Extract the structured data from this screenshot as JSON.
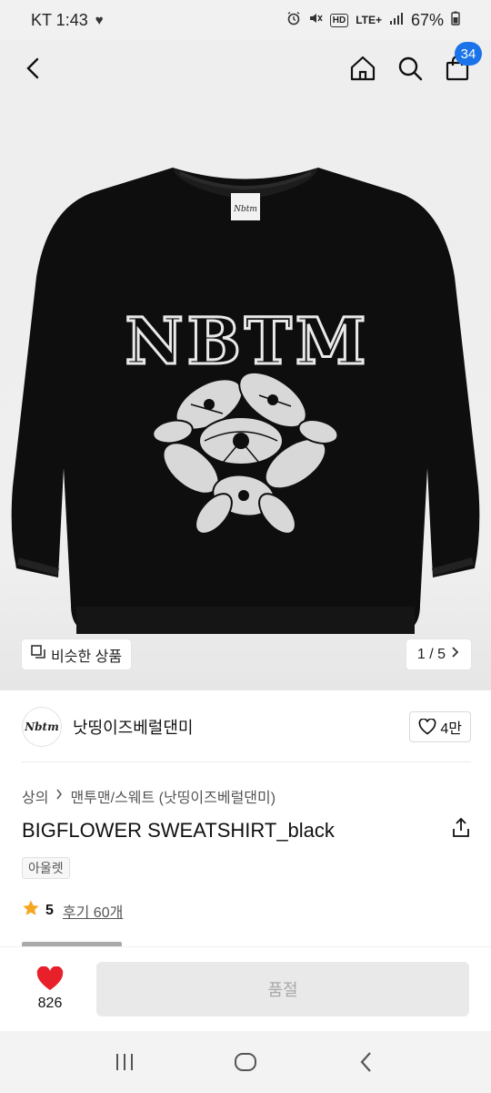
{
  "status_bar": {
    "carrier_time": "KT 1:43",
    "network": "LTE+",
    "battery": "67%"
  },
  "nav": {
    "cart_count": "34"
  },
  "product_image": {
    "similar_label": "비슷한 상품",
    "page_indicator": "1 / 5",
    "print_text": "NBTM",
    "tag_text": "Nbtm"
  },
  "brand": {
    "logo_text": "Nbtm",
    "name": "낫띵이즈베럴댄미",
    "likes": "4만"
  },
  "breadcrumb": {
    "category": "상의",
    "subcategory": "맨투맨/스웨트 (낫띵이즈베럴댄미)"
  },
  "product": {
    "title": "BIGFLOWER SWEATSHIRT_black",
    "tag": "아울렛",
    "rating": "5",
    "review_link": "후기 60개"
  },
  "bottom_bar": {
    "like_count": "826",
    "soldout_label": "품절"
  },
  "colors": {
    "accent_blue": "#1a73e8",
    "heart_red": "#e8202a",
    "star_orange": "#f6a623"
  }
}
